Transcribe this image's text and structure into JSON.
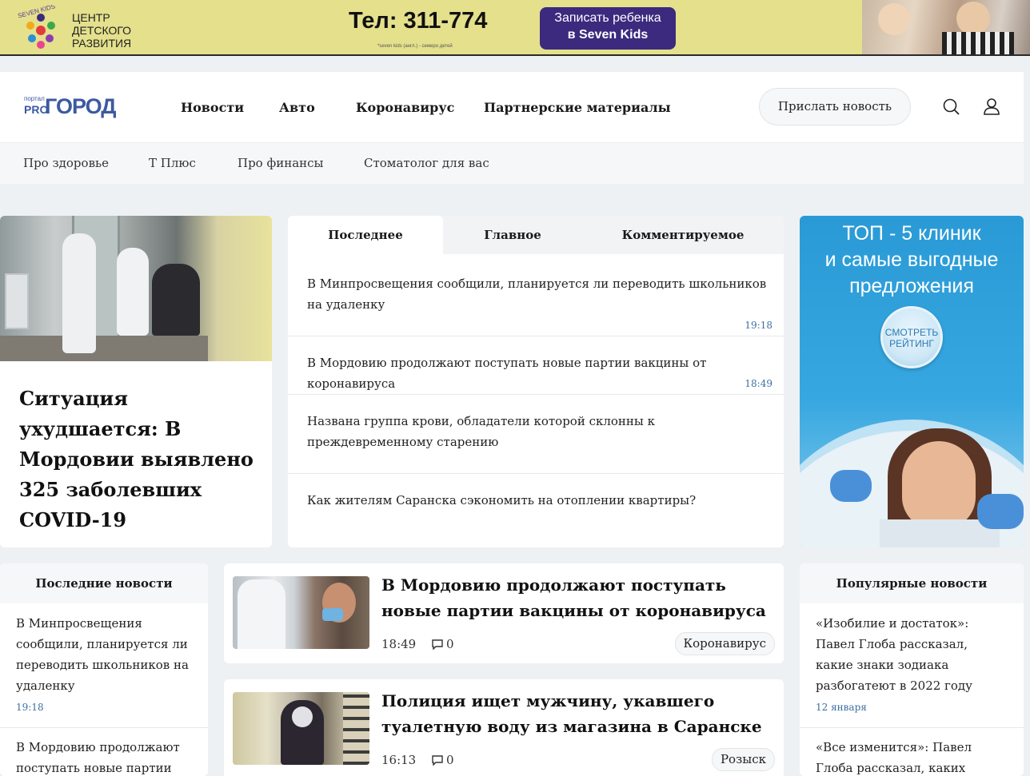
{
  "banner": {
    "logo_text": "SEVEN KIDS",
    "center_text": [
      "Центр",
      "детского",
      "развития"
    ],
    "phone": "Тел: 311-774",
    "note": "*seven kids (англ.) - семеро детей",
    "button_line1": "Записать ребенка",
    "button_line2": "в Seven Kids"
  },
  "header": {
    "logo_small": "портал",
    "logo_pro": "PRO",
    "logo_gorod": "ГОРОД",
    "nav": [
      "Новости",
      "Авто",
      "Коронавирус",
      "Партнерские материалы"
    ],
    "send_news": "Прислать новость",
    "icons": [
      "search-icon",
      "user-icon"
    ]
  },
  "subnav": [
    "Про здоровье",
    "Т Плюс",
    "Про финансы",
    "Стоматолог для вас"
  ],
  "feature": {
    "title": "Ситуация ухудшается: В Мордовии выявлено 325 заболевших COVID-19"
  },
  "tabs": {
    "items": [
      "Последнее",
      "Главное",
      "Комментируемое"
    ],
    "active": "Последнее",
    "news": [
      {
        "text": "В Минпросвещения сообщили, планируется ли переводить школьников на удаленку",
        "time": "19:18"
      },
      {
        "text": "В Мордовию продолжают поступать новые партии вакцины от коронавируса",
        "time": "18:49"
      },
      {
        "text": "Названа группа крови, обладатели которой склонны к преждевременному старению",
        "time": ""
      },
      {
        "text": "Как жителям Саранска сэкономить на отоплении квартиры?",
        "time": ""
      }
    ]
  },
  "ad": {
    "title_line1": "ТОП - 5 клиник",
    "title_line2": "и самые выгодные",
    "title_line3": "предложения",
    "button_line1": "СМОТРЕТЬ",
    "button_line2": "РЕЙТИНГ"
  },
  "latest": {
    "heading": "Последние новости",
    "items": [
      {
        "text": "В Минпросвещения сообщили, планируется ли переводить школьников на удаленку",
        "time": "19:18"
      },
      {
        "text": "В Мордовию продолжают поступать новые партии",
        "time": ""
      }
    ]
  },
  "cards": [
    {
      "title": "В Мордовию продолжают поступать новые партии вакцины от коронавируса",
      "time": "18:49",
      "comments": "0",
      "tag": "Коронавирус"
    },
    {
      "title": "Полиция ищет мужчину, укавшего туалетную воду из магазина в Саранске",
      "time": "16:13",
      "comments": "0",
      "tag": "Розыск"
    }
  ],
  "popular": {
    "heading": "Популярные новости",
    "items": [
      {
        "text": "«Изобилие и достаток»: Павел Глоба рассказал, какие знаки зодиака разбогатеют в 2022 году",
        "time": "12 января"
      },
      {
        "text": "«Все изменится»: Павел Глоба рассказал, каких знаков",
        "time": ""
      }
    ]
  }
}
